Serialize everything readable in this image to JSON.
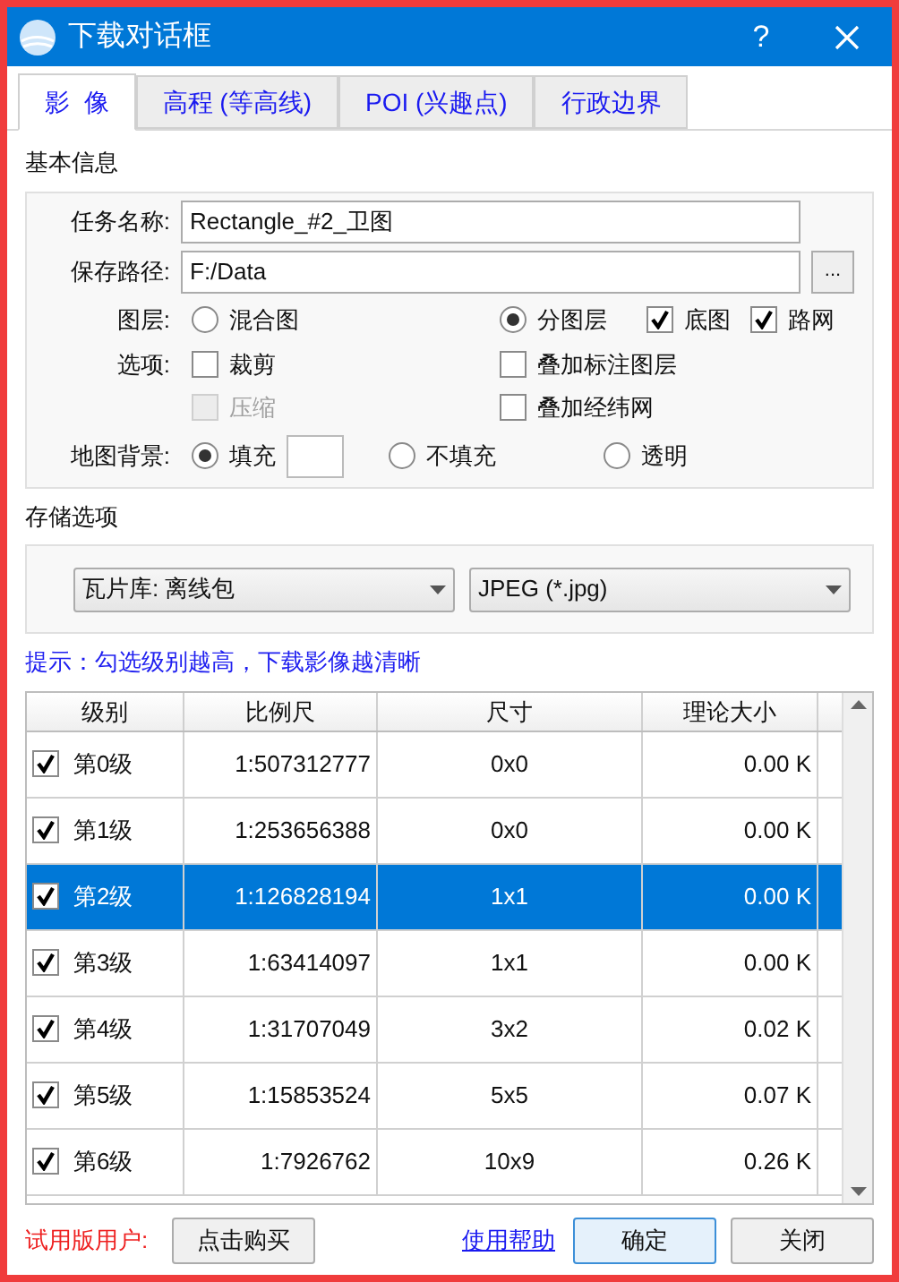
{
  "window": {
    "title": "下载对话框",
    "help": "?"
  },
  "tabs": [
    {
      "label": "影  像",
      "selected": true
    },
    {
      "label": "高程 (等高线)",
      "selected": false
    },
    {
      "label": "POI (兴趣点)",
      "selected": false
    },
    {
      "label": "行政边界",
      "selected": false
    }
  ],
  "basic_info": {
    "title": "基本信息",
    "task_name": {
      "label": "任务名称:",
      "value": "Rectangle_#2_卫图"
    },
    "save_path": {
      "label": "保存路径:",
      "value": "F:/Data",
      "browse": "..."
    },
    "layers": {
      "label": "图层:",
      "options": [
        {
          "kind": "radio",
          "label": "混合图",
          "selected": false
        },
        {
          "kind": "radio",
          "label": "分图层",
          "selected": true
        },
        {
          "kind": "checkbox",
          "label": "底图",
          "checked": true
        },
        {
          "kind": "checkbox",
          "label": "路网",
          "checked": true
        }
      ]
    },
    "options": {
      "label": "选项:",
      "items": [
        {
          "label": "裁剪",
          "checked": false,
          "disabled": false
        },
        {
          "label": "叠加标注图层",
          "checked": false,
          "disabled": false
        },
        {
          "label": "压缩",
          "checked": false,
          "disabled": true
        },
        {
          "label": "叠加经纬网",
          "checked": false,
          "disabled": false
        }
      ]
    },
    "background": {
      "label": "地图背景:",
      "options": [
        {
          "label": "填充",
          "selected": true,
          "swatch": true
        },
        {
          "label": "不填充",
          "selected": false
        },
        {
          "label": "透明",
          "selected": false
        }
      ]
    }
  },
  "storage": {
    "title": "存储选项",
    "selects": [
      "瓦片库: 离线包",
      "JPEG (*.jpg)"
    ]
  },
  "hint": "提示：勾选级别越高，下载影像越清晰",
  "table": {
    "columns": [
      "级别",
      "比例尺",
      "尺寸",
      "理论大小"
    ],
    "rows": [
      {
        "checked": true,
        "selected": false,
        "cells": [
          "第0级",
          "1:507312777",
          "0x0",
          "0.00 K"
        ]
      },
      {
        "checked": true,
        "selected": false,
        "cells": [
          "第1级",
          "1:253656388",
          "0x0",
          "0.00 K"
        ]
      },
      {
        "checked": true,
        "selected": true,
        "cells": [
          "第2级",
          "1:126828194",
          "1x1",
          "0.00 K"
        ]
      },
      {
        "checked": true,
        "selected": false,
        "cells": [
          "第3级",
          "1:63414097",
          "1x1",
          "0.00 K"
        ]
      },
      {
        "checked": true,
        "selected": false,
        "cells": [
          "第4级",
          "1:31707049",
          "3x2",
          "0.02 K"
        ]
      },
      {
        "checked": true,
        "selected": false,
        "cells": [
          "第5级",
          "1:15853524",
          "5x5",
          "0.07 K"
        ]
      },
      {
        "checked": true,
        "selected": false,
        "cells": [
          "第6级",
          "1:7926762",
          "10x9",
          "0.26 K"
        ]
      }
    ]
  },
  "footer": {
    "trial_label": "试用版用户:",
    "buy": "点击购买",
    "help_link": "使用帮助",
    "ok": "确定",
    "close": "关闭"
  }
}
